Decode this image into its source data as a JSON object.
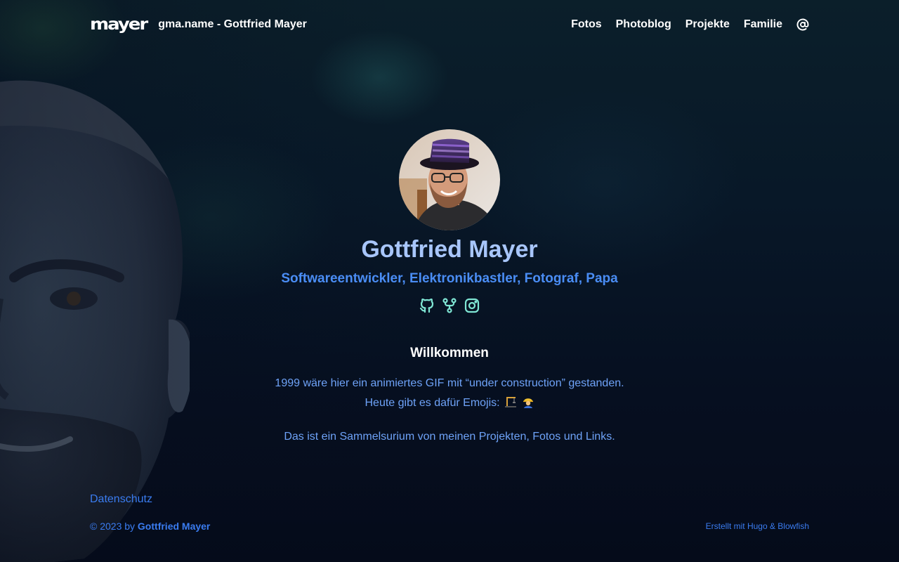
{
  "header": {
    "logo_text": "mayer",
    "site_title": "gma.name - Gottfried Mayer",
    "nav": [
      {
        "label": "Fotos"
      },
      {
        "label": "Photoblog"
      },
      {
        "label": "Projekte"
      },
      {
        "label": "Familie"
      }
    ],
    "contact_icon": "at-icon"
  },
  "profile": {
    "name": "Gottfried Mayer",
    "tagline": "Softwareentwickler, Elektronikbastler, Fotograf, Papa",
    "socials": [
      {
        "icon": "github-icon"
      },
      {
        "icon": "git-fork-icon"
      },
      {
        "icon": "instagram-icon"
      }
    ]
  },
  "welcome": {
    "title": "Willkommen",
    "line1": "1999 wäre hier ein animiertes GIF mit “under construction” gestanden.",
    "line2": "Heute gibt es dafür Emojis:",
    "emojis": [
      "construction-crane-icon",
      "construction-worker-icon"
    ],
    "line3": "Das ist ein Sammelsurium von meinen Projekten, Fotos und Links."
  },
  "footer": {
    "privacy_link": "Datenschutz",
    "copyright_prefix": "© 2023 by",
    "copyright_name": "Gottfried Mayer",
    "built_with": "Erstellt mit Hugo & Blowfish"
  },
  "colors": {
    "name": "#a8c6fb",
    "tagline": "#4a8df5",
    "text": "#6ea2f7",
    "link": "#3a7cf0",
    "social_icons": "#7fe6d4"
  }
}
